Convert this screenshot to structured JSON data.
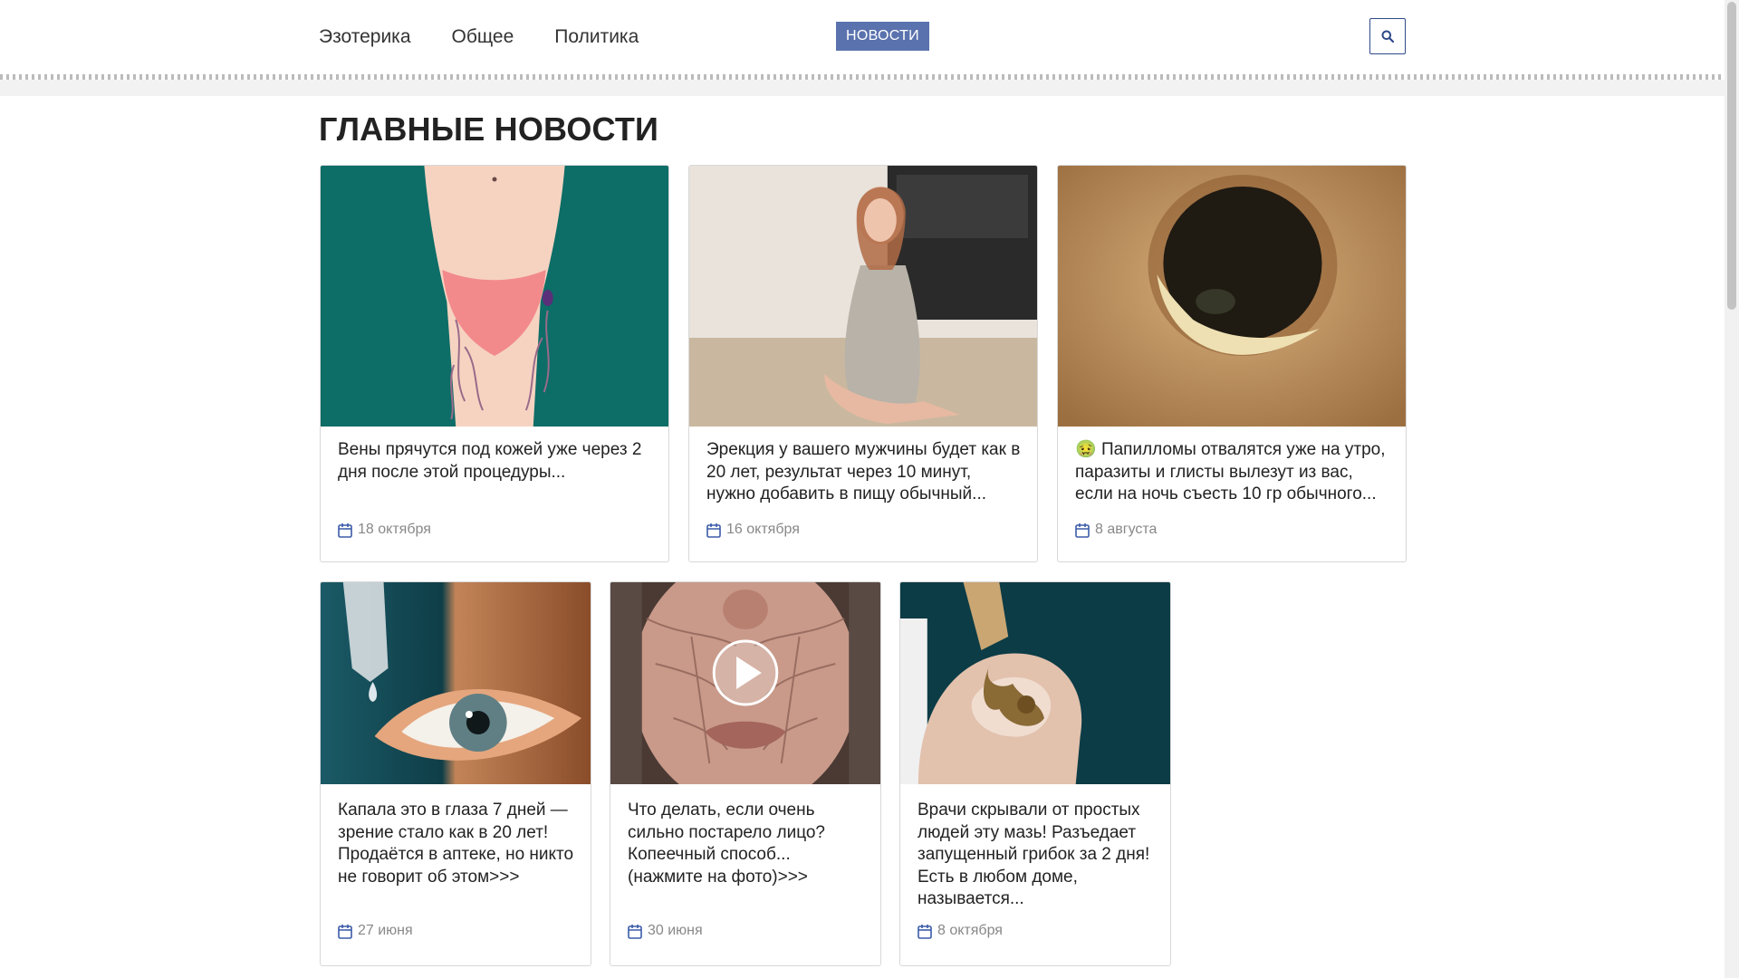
{
  "nav": {
    "items": [
      "Эзотерика",
      "Общее",
      "Политика"
    ],
    "badge": "НОВОСТИ"
  },
  "icons": {
    "search": "search-icon",
    "calendar": "calendar-icon",
    "play": "play-icon",
    "emoji": "nauseated-face-emoji"
  },
  "colors": {
    "badge": "#5a72ae",
    "calendar": "#3b5ba9",
    "date_text": "#888888"
  },
  "section": {
    "heading": "ГЛАВНЫЕ НОВОСТИ"
  },
  "cards": [
    {
      "title": "Вены прячутся под кожей уже через 2 дня после этой процедуры...",
      "date": "18 октября"
    },
    {
      "title": "Эрекция у вашего мужчины будет как в 20 лет, результат через 10 минут, нужно добавить в пищу обычный...",
      "date": "16 октября"
    },
    {
      "emoji": "🤢",
      "title": "Папилломы отвалятся уже на утро, паразиты и глисты вылезут из вас, если на ночь съесть 10 гр обычного...",
      "date": "8 августа"
    },
    {
      "title": "Капала это в глаза 7 дней — зрение стало как в 20 лет! Продаётся в аптеке, но никто не говорит об этом>>>",
      "date": "27 июня"
    },
    {
      "title": "Что делать, если очень сильно постарело лицо? Копеечный способ... (нажмите на фото)>>>",
      "date": "30 июня"
    },
    {
      "title": "Врачи скрывали от простых людей эту мазь! Разъедает запущенный грибок за 2 дня! Есть в любом доме, называется...",
      "date": "8 октября"
    }
  ]
}
